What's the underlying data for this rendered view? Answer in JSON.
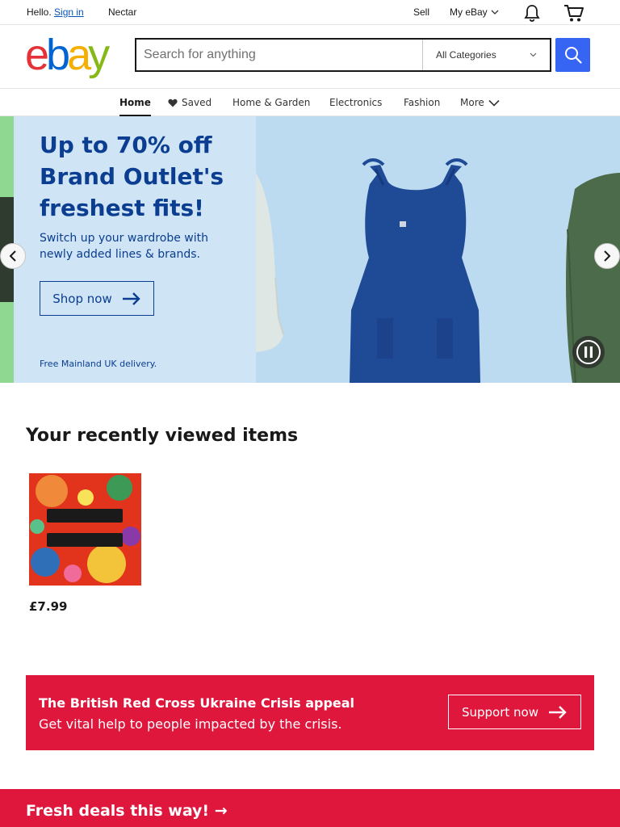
{
  "topbar": {
    "greeting": "Hello.",
    "sign_in": "Sign in",
    "nectar": "Nectar",
    "sell": "Sell",
    "my_ebay": "My eBay"
  },
  "header": {
    "logo": [
      "e",
      "b",
      "a",
      "y"
    ],
    "search_placeholder": "Search for anything",
    "category": "All Categories"
  },
  "nav": {
    "items": [
      {
        "label": "Home",
        "icon": ""
      },
      {
        "label": "Saved",
        "icon": "heart-icon"
      },
      {
        "label": "Home & Garden",
        "icon": ""
      },
      {
        "label": "Electronics",
        "icon": ""
      },
      {
        "label": "Fashion",
        "icon": ""
      },
      {
        "label": "More",
        "icon": "chevron-down-icon"
      }
    ]
  },
  "hero": {
    "heading": "Up to 70% off Brand Outlet's freshest fits!",
    "subtext": "Switch up your wardrobe with newly added lines & brands.",
    "cta": "Shop now",
    "footnote": "Free Mainland UK delivery."
  },
  "recently_viewed": {
    "title": "Your recently viewed items",
    "items": [
      {
        "price": "£7.99"
      }
    ]
  },
  "appeal": {
    "title": "The British Red Cross Ukraine Crisis appeal",
    "text": "Get vital help to people impacted by the crisis.",
    "cta": "Support now"
  },
  "fresh_deals": {
    "label": "Fresh deals this way! →"
  },
  "colors": {
    "accent": "#3665f3",
    "hero_text": "#0b3d91",
    "appeal_bg": "#e0173d",
    "link": "#0654ba"
  }
}
